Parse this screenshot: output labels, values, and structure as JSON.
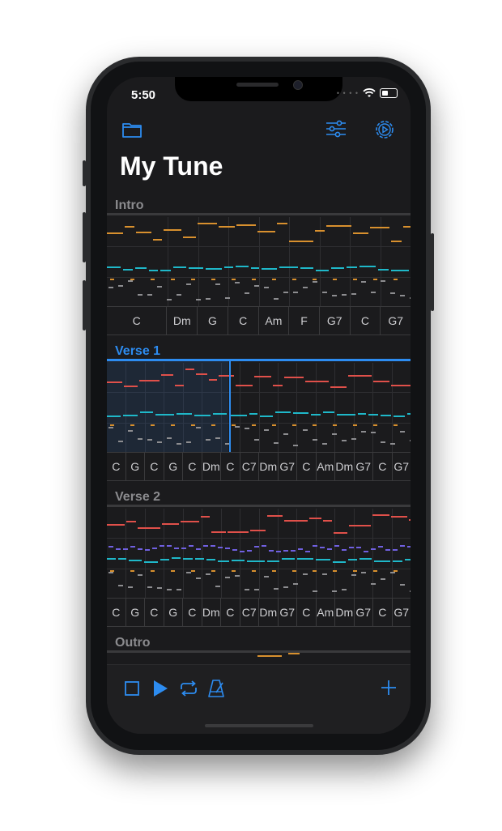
{
  "status": {
    "time": "5:50"
  },
  "title": "My Tune",
  "sections": [
    {
      "name": "Intro",
      "active": false,
      "chords": [
        "C",
        "Dm",
        "G",
        "C",
        "Am",
        "F",
        "G7",
        "C",
        "G7"
      ],
      "chord_flex": [
        2,
        1,
        1,
        1,
        1,
        1,
        1,
        1,
        1
      ]
    },
    {
      "name": "Verse 1",
      "active": true,
      "chords": [
        "C",
        "G",
        "C",
        "G",
        "C",
        "Dm",
        "C",
        "C7",
        "Dm",
        "G7",
        "C",
        "Am",
        "Dm",
        "G7",
        "C",
        "G7"
      ]
    },
    {
      "name": "Verse 2",
      "active": false,
      "chords": [
        "C",
        "G",
        "C",
        "G",
        "C",
        "Dm",
        "C",
        "C7",
        "Dm",
        "G7",
        "C",
        "Am",
        "Dm",
        "G7",
        "C",
        "G7"
      ]
    },
    {
      "name": "Outro",
      "active": false,
      "chords": []
    }
  ],
  "colors": {
    "accent": "#2d8cf0",
    "melody": "#e0504a",
    "intro_melody": "#d8902e",
    "bass": "#1fb8c9",
    "harmony": "#7060e0"
  },
  "icons": {
    "folder": "folder-icon",
    "mixer": "sliders-icon",
    "settings": "gear-icon",
    "stop": "stop-icon",
    "play": "play-icon",
    "loop": "loop-icon",
    "metronome": "metronome-icon",
    "add": "plus-icon"
  }
}
